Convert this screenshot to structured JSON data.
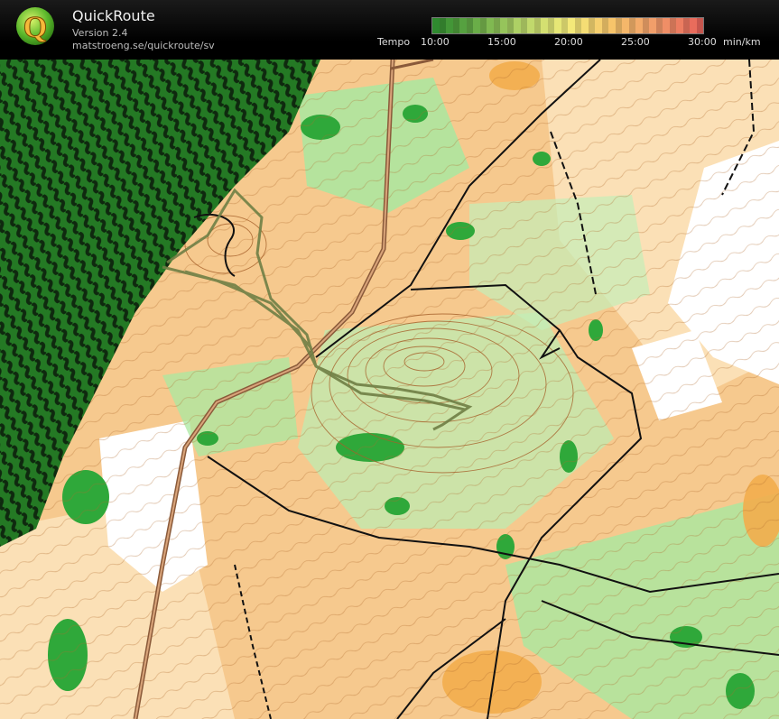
{
  "app": {
    "title": "QuickRoute",
    "version": "Version 2.4",
    "url": "matstroeng.se/quickroute/sv"
  },
  "legend": {
    "label": "Tempo",
    "ticks": [
      "10:00",
      "15:00",
      "20:00",
      "25:00",
      "30:00"
    ],
    "unit": "min/km",
    "gradient_colors": [
      "#2f8a2f",
      "#6fb04a",
      "#b8d66a",
      "#f4ec7a",
      "#f7c46a",
      "#f19b6a",
      "#e8645a"
    ]
  },
  "map": {
    "colors": {
      "open_land": "#f6c98e",
      "semi_open": "#fbe3c0",
      "white_forest": "#ffffff",
      "green_light": "#a9e8a0",
      "green_dark": "#2fa83a",
      "contour": "#b06a2c",
      "path": "#1a1a1a",
      "route": "#6f7f45"
    }
  }
}
